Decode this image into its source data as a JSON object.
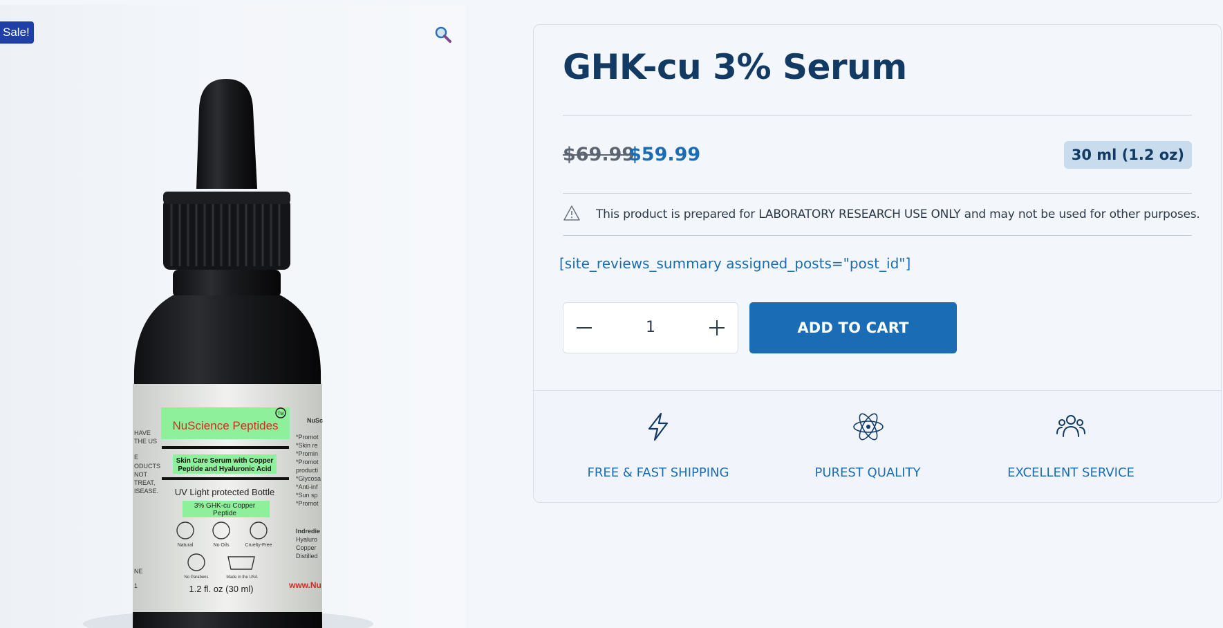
{
  "gallery": {
    "sale_badge": "Sale!",
    "zoom_icon": "magnifier-icon",
    "label": {
      "brand": "NuScience Peptides",
      "tm": "TM",
      "product_line": "Skin Care Serum with Copper Peptide and Hyaluronic Acid",
      "uv_text": "UV Light protected Bottle",
      "strength": "3% GHK-cu Copper Peptide",
      "icons": [
        "Natural",
        "No Oils",
        "Cruelty-Free",
        "No Parabens",
        "Made in the USA"
      ],
      "volume": "1.2 fl. oz (30 ml)",
      "right_heading": "NuSc",
      "website": "www.Nu",
      "ingredients_heading": "Indredie"
    }
  },
  "product": {
    "title": "GHK-cu 3% Serum",
    "price_old": "$69.99",
    "price_new": "$59.99",
    "size_option": "30 ml (1.2 oz)",
    "notice": "This product is prepared for LABORATORY RESEARCH USE ONLY and may not be used for other purposes.",
    "shortcode": "[site_reviews_summary assigned_posts=\"post_id\"]",
    "quantity": "1",
    "add_to_cart": "ADD TO CART"
  },
  "features": [
    {
      "label": "FREE & FAST SHIPPING",
      "icon": "lightning-icon"
    },
    {
      "label": "PUREST QUALITY",
      "icon": "atom-icon"
    },
    {
      "label": "EXCELLENT SERVICE",
      "icon": "users-icon"
    }
  ],
  "colors": {
    "accent": "#1a6db5",
    "title": "#123a63",
    "sale_badge": "#1f3fa8",
    "size_pill": "#c8dcee"
  }
}
